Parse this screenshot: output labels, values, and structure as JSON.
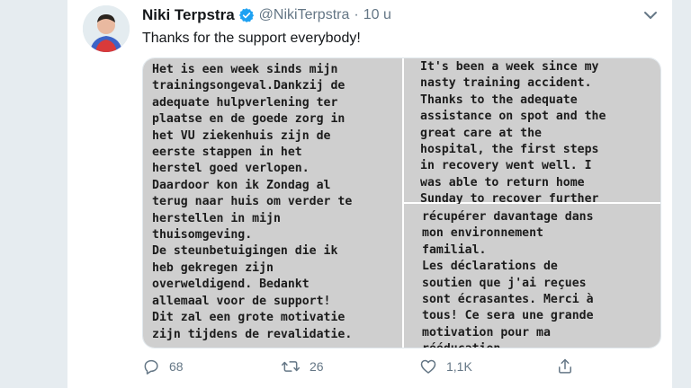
{
  "tweet": {
    "author_name": "Niki Terpstra",
    "handle": "@NikiTerpstra",
    "separator": "·",
    "time": "10 u",
    "text": "Thanks for the support everybody!",
    "icons": {
      "verified": "verified-badge-icon",
      "caret": "chevron-down-icon",
      "reply": "reply-icon",
      "retweet": "retweet-icon",
      "like": "heart-icon",
      "share": "share-icon"
    },
    "accent_color": "#1da1f2"
  },
  "media": {
    "dutch_text": "Het is een week sinds mijn\ntrainingsongeval.Dankzij de\nadequate hulpverlening ter\nplaatse en de goede zorg in\nhet VU ziekenhuis zijn de\neerste stappen in het\nherstel goed verlopen.\nDaardoor kon ik Zondag al\nterug naar huis om verder te\nherstellen in mijn\nthuisomgeving.\nDe steunbetuigingen die ik\nheb gekregen zijn\noverweldigend. Bedankt\nallemaal voor de support!\nDit zal een grote motivatie\nzijn tijdens de revalidatie.",
    "english_text": "It's been a week since my\nnasty training accident.\nThanks to the adequate\nassistance on spot and the\ngreat care at the\nhospital, the first steps\nin recovery went well. I\nwas able to return home\nSunday to recover further",
    "french_text": "récupérer davantage dans\nmon environnement\nfamilial.\nLes déclarations de\nsoutien que j'ai reçues\nsont écrasantes. Merci à\ntous! Ce sera une grande\nmotivation pour ma\nrééducation."
  },
  "actions": {
    "replies": "68",
    "retweets": "26",
    "likes": "1,1K"
  }
}
